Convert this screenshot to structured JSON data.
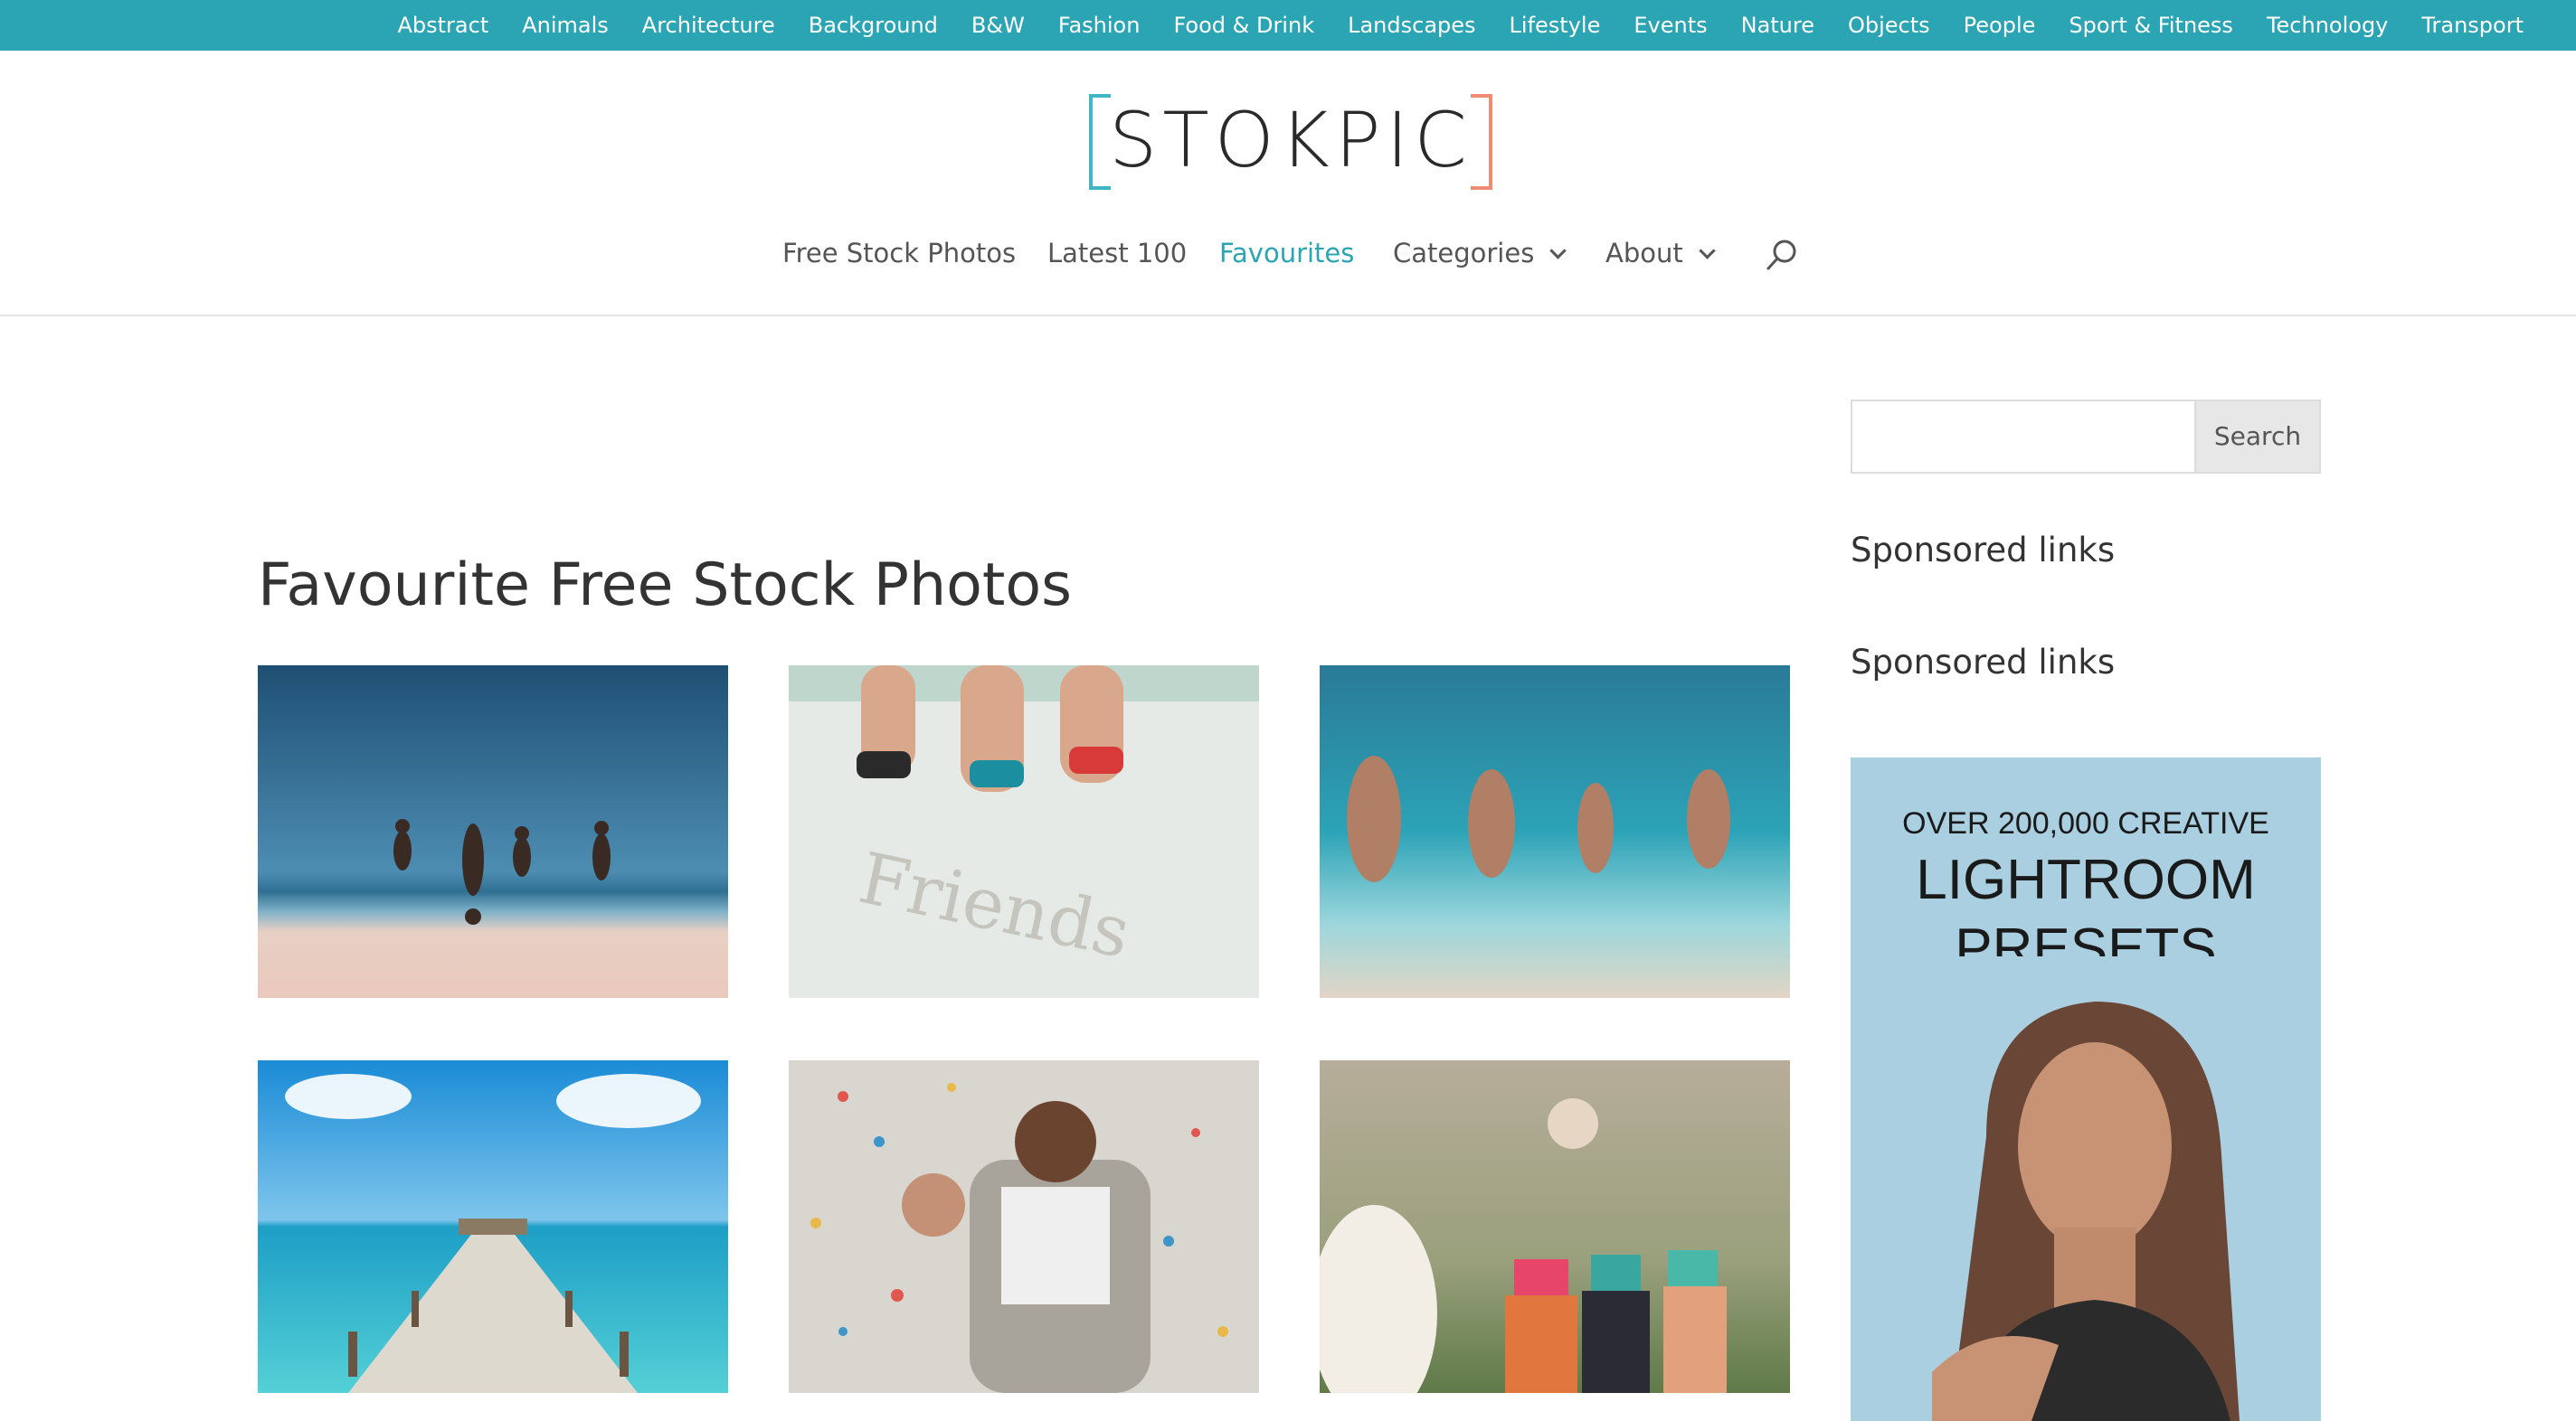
{
  "topbar": {
    "categories": [
      "Abstract",
      "Animals",
      "Architecture",
      "Background",
      "B&W",
      "Fashion",
      "Food & Drink",
      "Landscapes",
      "Lifestyle",
      "Events",
      "Nature",
      "Objects",
      "People",
      "Sport & Fitness",
      "Technology",
      "Transport"
    ]
  },
  "header": {
    "logo_text": "STOKPIC",
    "nav": {
      "free_stock_photos": "Free Stock Photos",
      "latest_100": "Latest 100",
      "favourites": "Favourites",
      "categories": "Categories",
      "about": "About"
    }
  },
  "main": {
    "title": "Favourite Free Stock Photos",
    "photos": [
      {
        "subject": "beach-jumping-group"
      },
      {
        "subject": "friends-sand-jump"
      },
      {
        "subject": "running-into-sea"
      },
      {
        "subject": "tropical-pier"
      },
      {
        "subject": "wedding-confetti"
      },
      {
        "subject": "bouquet-toss"
      }
    ]
  },
  "sidebar": {
    "search_placeholder": "",
    "search_button": "Search",
    "sponsored_1": "Sponsored links",
    "sponsored_2": "Sponsored links",
    "ad": {
      "line1": "OVER 200,000 CREATIVE",
      "line2": "LIGHTROOM",
      "line3": "PRESETS"
    }
  },
  "colors": {
    "accent": "#2ba4b3",
    "logo_left_bracket": "#3fb6c6",
    "logo_right_bracket": "#ef8a74"
  },
  "icons": [
    "search-icon",
    "chevron-down-icon"
  ]
}
